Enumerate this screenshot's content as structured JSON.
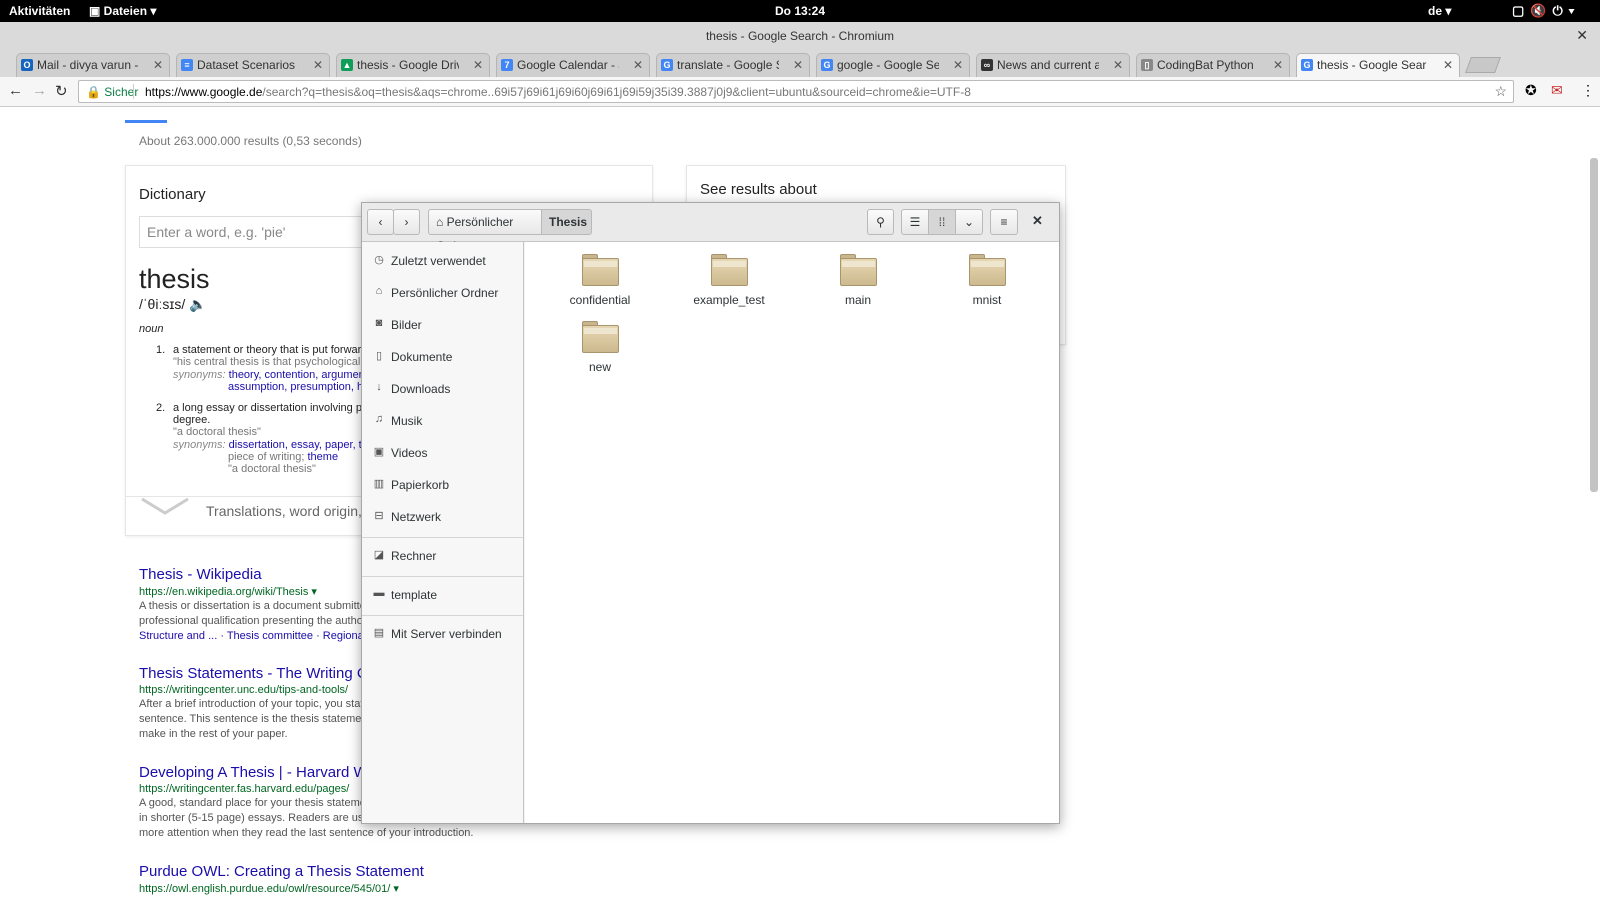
{
  "topbar": {
    "activities": "Aktivitäten",
    "app_menu": "Dateien",
    "clock": "Do 13:24",
    "lang": "de"
  },
  "window": {
    "title": "thesis - Google Search - Chromium"
  },
  "tabs": [
    {
      "label": "Mail - divya varun -",
      "favicon": "mail-icon",
      "color": "#1565c0"
    },
    {
      "label": "Dataset Scenarios -",
      "favicon": "docs-icon",
      "color": "#4285f4"
    },
    {
      "label": "thesis - Google Driv",
      "favicon": "drive-icon",
      "color": "#0f9d58"
    },
    {
      "label": "Google Calendar - J",
      "favicon": "calendar-icon",
      "color": "#4285f4"
    },
    {
      "label": "translate - Google S",
      "favicon": "google-icon",
      "color": "#4285f4"
    },
    {
      "label": "google - Google Sea",
      "favicon": "google-icon",
      "color": "#4285f4"
    },
    {
      "label": "News and current af",
      "favicon": "news-icon",
      "color": "#333333"
    },
    {
      "label": "CodingBat Python",
      "favicon": "page-icon",
      "color": "#888888"
    },
    {
      "label": "thesis - Google Sear",
      "favicon": "google-icon",
      "color": "#4285f4"
    }
  ],
  "omnibox": {
    "security": "Sicher",
    "url_domain": "https://www.google.de",
    "url_path": "/search?q=thesis&oq=thesis&aqs=chrome..69i57j69i61j69i60j69i61j69i59j35i39.3887j0j9&client=ubuntu&sourceid=chrome&ie=UTF-8"
  },
  "results_page": {
    "count": "About 263.000.000 results (0,53 seconds)",
    "dictionary": {
      "heading": "Dictionary",
      "input_placeholder": "Enter a word, e.g. 'pie'",
      "word": "thesis",
      "pronunciation": "/ˈθiːsɪs/",
      "pos": "noun",
      "def1": "a statement or theory that is put forward",
      "def1_example": "\"his central thesis is that psychological",
      "syn_label": "synonyms:",
      "def1_syn1": "theory, contention, argumen",
      "def1_syn2": "assumption, presumption, h",
      "def2_line1": "a long essay or dissertation involving pe",
      "def2_line2": "degree.",
      "def2_example": "\"a doctoral thesis\"",
      "def2_syn1": "dissertation, essay, paper, t",
      "def2_syn2_text": "piece of writing;",
      "def2_syn2_link": "theme",
      "def2_syn3": "\"a doctoral thesis\"",
      "translations": "Translations, word origin, a"
    },
    "see_results": "See results about",
    "results": [
      {
        "title": "Thesis - Wikipedia",
        "url": "https://en.wikipedia.org/wiki/Thesis",
        "snippet1": "A thesis or dissertation is a document submitte",
        "snippet2": "professional qualification presenting the author",
        "links": "Structure and ... · Thesis committee · Regional"
      },
      {
        "title": "Thesis Statements - The Writing C",
        "url": "https://writingcenter.unc.edu/tips-and-tools/",
        "snippet1": "After a brief introduction of your topic, you stat",
        "snippet2": "sentence. This sentence is the thesis stateme",
        "snippet3": "make in the rest of your paper."
      },
      {
        "title": "Developing A Thesis | - Harvard W",
        "url": "https://writingcenter.fas.harvard.edu/pages/",
        "snippet1": "A good, standard place for your thesis stateme",
        "snippet2": "in shorter (5-15 page) essays. Readers are us",
        "snippet3": "more attention when they read the last sentence of your introduction."
      },
      {
        "title": "Purdue OWL: Creating a Thesis Statement",
        "url": "https://owl.english.purdue.edu/owl/resource/545/01/"
      }
    ]
  },
  "file_dialog": {
    "path": [
      "Persönlicher Ordner",
      "Thesis"
    ],
    "places": [
      {
        "label": "Zuletzt verwendet",
        "icon": "clock-icon",
        "glyph": "◷"
      },
      {
        "label": "Persönlicher Ordner",
        "icon": "home-icon",
        "glyph": "⌂"
      },
      {
        "label": "Bilder",
        "icon": "camera-icon",
        "glyph": "◙"
      },
      {
        "label": "Dokumente",
        "icon": "document-icon",
        "glyph": "▯"
      },
      {
        "label": "Downloads",
        "icon": "download-icon",
        "glyph": "↓"
      },
      {
        "label": "Musik",
        "icon": "music-icon",
        "glyph": "♫"
      },
      {
        "label": "Videos",
        "icon": "film-icon",
        "glyph": "▣"
      },
      {
        "label": "Papierkorb",
        "icon": "trash-icon",
        "glyph": "▥"
      },
      {
        "label": "Netzwerk",
        "icon": "network-icon",
        "glyph": "⊟"
      },
      {
        "label": "Rechner",
        "icon": "computer-icon",
        "glyph": "◪"
      },
      {
        "label": "template",
        "icon": "folder-icon",
        "glyph": "▬"
      },
      {
        "label": "Mit Server verbinden",
        "icon": "server-icon",
        "glyph": "▤"
      }
    ],
    "folders": [
      "confidential",
      "example_test",
      "main",
      "mnist",
      "new"
    ]
  }
}
